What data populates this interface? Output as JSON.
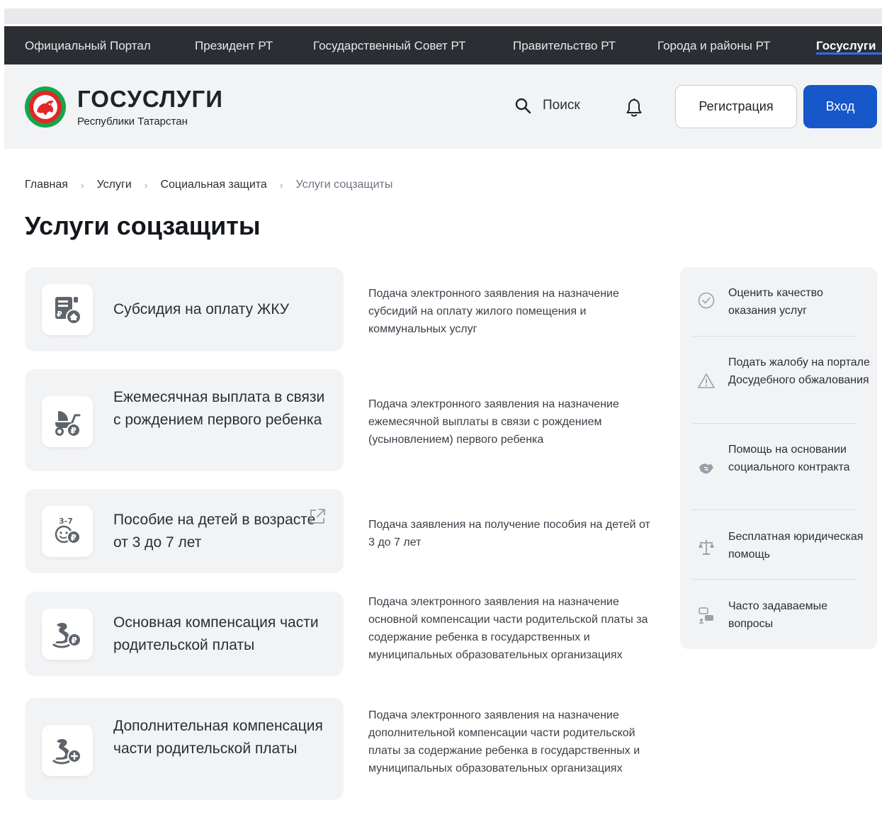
{
  "topnav": {
    "items": [
      {
        "label": "Официальный Портал"
      },
      {
        "label": "Президент РТ"
      },
      {
        "label": "Государственный Совет РТ"
      },
      {
        "label": "Правительство РТ"
      },
      {
        "label": "Города и районы РТ"
      },
      {
        "label": "Госуслуги"
      }
    ]
  },
  "header": {
    "logo_title": "ГОСУСЛУГИ",
    "logo_subtitle": "Республики Татарстан",
    "search_label": "Поиск",
    "register_label": "Регистрация",
    "login_label": "Вход"
  },
  "breadcrumb": {
    "items": [
      "Главная",
      "Услуги",
      "Социальная защита",
      "Услуги соцзащиты"
    ],
    "separator": "›"
  },
  "page_title": "Услуги соцзащиты",
  "services": [
    {
      "title": "Субсидия на оплату ЖКУ",
      "description": "Подача электронного заявления на назначение субсидий на оплату жилого помещения и коммунальных услуг",
      "icon": "utility-bill-icon"
    },
    {
      "title": "Ежемесячная выплата в связи с рождением первого ребенка",
      "description": "Подача электронного заявления на назначение ежемесячной выплаты в связи с рождением (усыновлением) первого ребенка",
      "icon": "stroller-ruble-icon"
    },
    {
      "title": "Пособие на детей в возрасте от 3 до 7 лет",
      "description": "Подача заявления на получение пособия на детей от 3 до 7 лет",
      "icon": "child-3-7-icon",
      "external_icon": "external-link-icon",
      "icon_badge": "3-7"
    },
    {
      "title": "Основная компенсация части родительской платы",
      "description": "Подача электронного заявления на назначение основной компенсации части родительской платы за содержание ребенка в государственных и муниципальных образовательных организациях",
      "icon": "toy-horse-ruble-icon"
    },
    {
      "title": "Дополнительная компенсация части родительской платы",
      "description": "Подача электронного заявления на назначение дополнительной компенсации части родительской платы за содержание ребенка в государственных и муниципальных образовательных организациях",
      "icon": "toy-horse-plus-icon"
    }
  ],
  "sidebar": {
    "items": [
      {
        "label": "Оценить качество оказания услуг",
        "icon": "check-circle-icon"
      },
      {
        "label": "Подать жалобу на портале Досудебного обжалования",
        "icon": "warning-icon"
      },
      {
        "label": "Помощь на основании социального контракта",
        "icon": "handshake-icon"
      },
      {
        "label": "Бесплатная юридическая помощь",
        "icon": "scales-icon"
      },
      {
        "label": "Часто задаваемые вопросы",
        "icon": "faq-icon"
      }
    ]
  },
  "colors": {
    "topnav_bg": "#2b2e33",
    "header_bg": "#f2f3f5",
    "primary_button": "#1657c9",
    "icon_gray": "#5f646c",
    "emblem_red": "#e3262a",
    "emblem_green": "#14a64a"
  }
}
